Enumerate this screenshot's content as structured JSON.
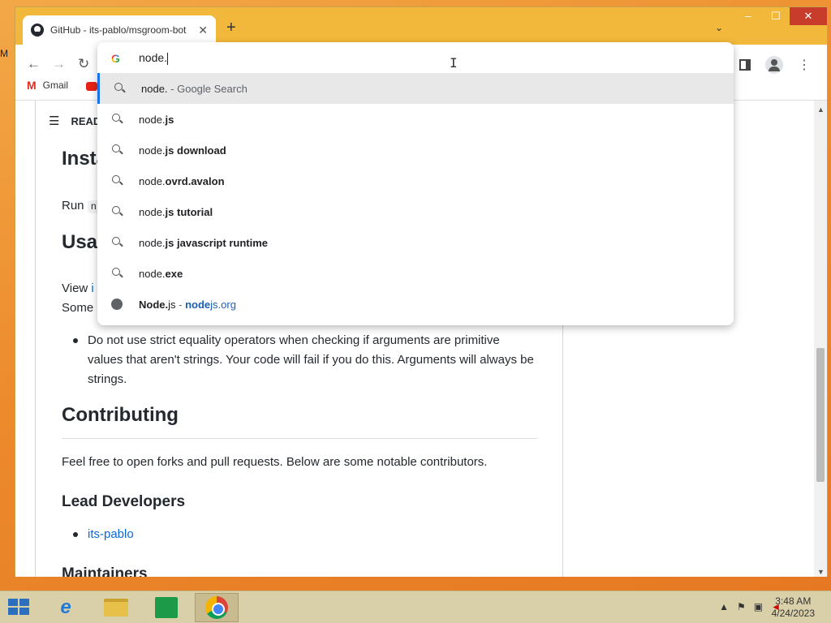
{
  "desktop": {
    "sliver_text": "M"
  },
  "browser": {
    "tab": {
      "title": "GitHub - its-pablo/msgroom-bot",
      "close": "✕"
    },
    "new_tab": "+",
    "window_controls": {
      "minimize": "–",
      "maximize": "☐",
      "close": "✕"
    },
    "nav": {
      "back": "←",
      "forward": "→",
      "reload": "↻"
    },
    "bookmarks": [
      {
        "label": "Gmail"
      }
    ],
    "omnibox": {
      "query": "node.",
      "suggestions": [
        {
          "type": "search",
          "typed": "node.",
          "completion": "",
          "suffix": " - Google Search"
        },
        {
          "type": "search",
          "typed": "node.",
          "completion": "js",
          "suffix": ""
        },
        {
          "type": "search",
          "typed": "node.",
          "completion": "js download",
          "suffix": ""
        },
        {
          "type": "search",
          "typed": "node.",
          "completion": "ovrd.avalon",
          "suffix": ""
        },
        {
          "type": "search",
          "typed": "node.",
          "completion": "js tutorial",
          "suffix": ""
        },
        {
          "type": "search",
          "typed": "node.",
          "completion": "js javascript runtime",
          "suffix": ""
        },
        {
          "type": "search",
          "typed": "node.",
          "completion": "exe",
          "suffix": ""
        },
        {
          "type": "site",
          "title_bold": "Node.",
          "title_rest": "js",
          "separator": " - ",
          "url_bold": "node",
          "url_rest": "js.org"
        }
      ]
    }
  },
  "page": {
    "readme_label": "READ",
    "install_heading": "Insta",
    "run_text": "Run",
    "usage_heading": "Usag",
    "view_text": "View",
    "view_link": "i",
    "some_text": "Some",
    "bullet_text": "Do not use strict equality operators when checking if arguments are primitive values that aren't strings. Your code will fail if you do this. Arguments will always be strings.",
    "contributing_heading": "Contributing",
    "contributing_text": "Feel free to open forks and pull requests. Below are some notable contributors.",
    "lead_heading": "Lead Developers",
    "lead_items": [
      "its-pablo"
    ],
    "maintainers_heading": "Maintainers"
  },
  "taskbar": {
    "clock_time": "3:48 AM",
    "clock_date": "4/24/2023"
  }
}
